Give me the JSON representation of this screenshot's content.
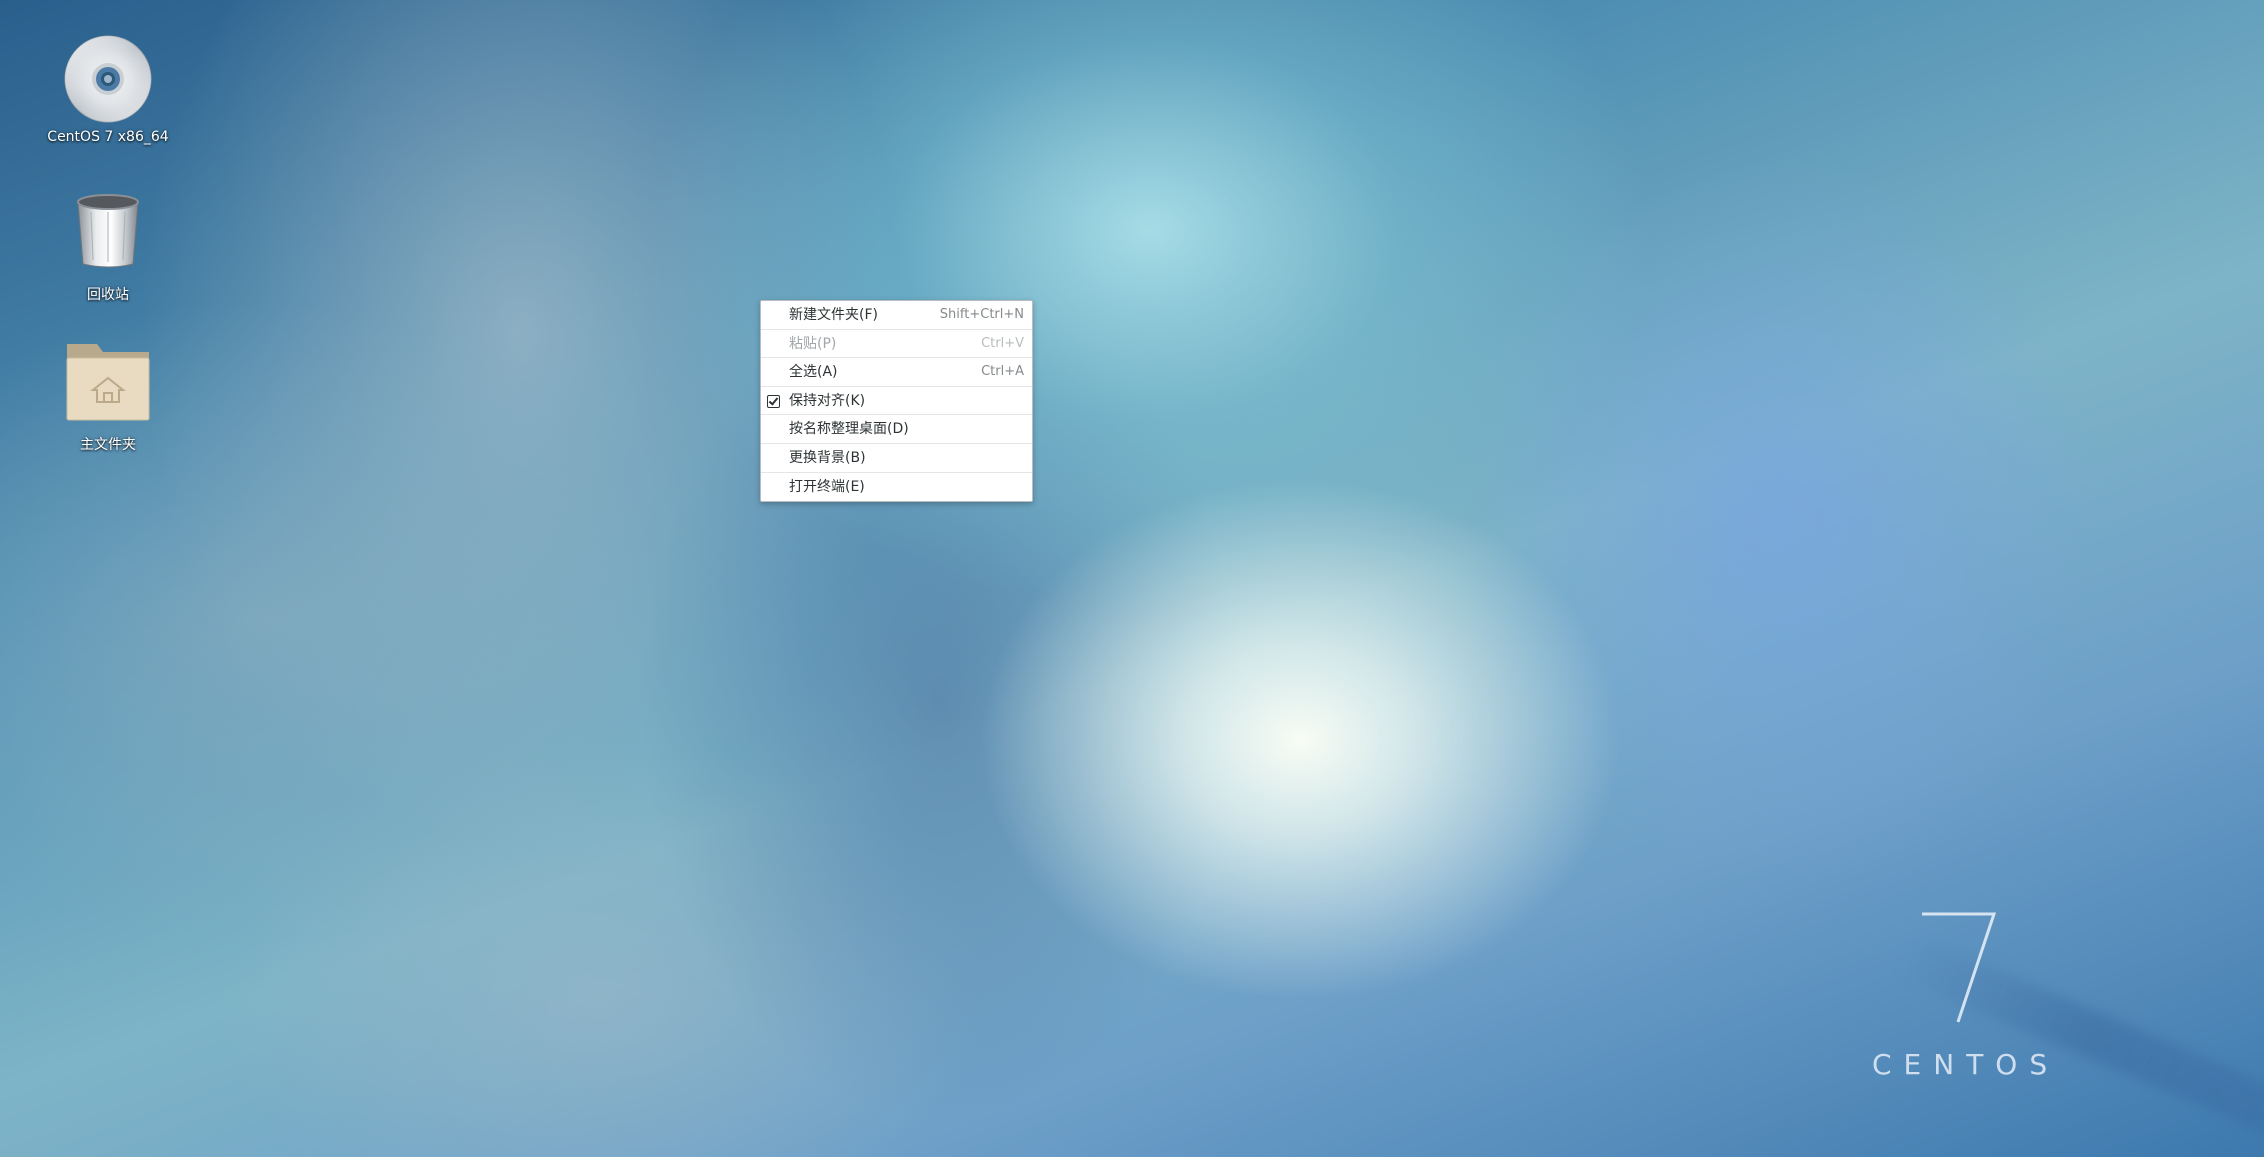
{
  "desktop": {
    "icons": [
      {
        "label": "CentOS 7 x86_64",
        "icon": "cd-icon"
      },
      {
        "label": "回收站",
        "icon": "trash-icon"
      },
      {
        "label": "主文件夹",
        "icon": "home-folder-icon"
      }
    ]
  },
  "context_menu": {
    "items": [
      {
        "label": "新建文件夹(F)",
        "shortcut": "Shift+Ctrl+N",
        "enabled": true
      },
      {
        "label": "粘贴(P)",
        "shortcut": "Ctrl+V",
        "enabled": false
      },
      {
        "label": "全选(A)",
        "shortcut": "Ctrl+A",
        "enabled": true
      },
      {
        "label": "保持对齐(K)",
        "checked": true,
        "enabled": true
      },
      {
        "label": "按名称整理桌面(D)",
        "enabled": true
      },
      {
        "label": "更换背景(B)",
        "enabled": true
      },
      {
        "label": "打开终端(E)",
        "enabled": true
      }
    ]
  },
  "brand": {
    "number": "7",
    "name": "CENTOS"
  }
}
